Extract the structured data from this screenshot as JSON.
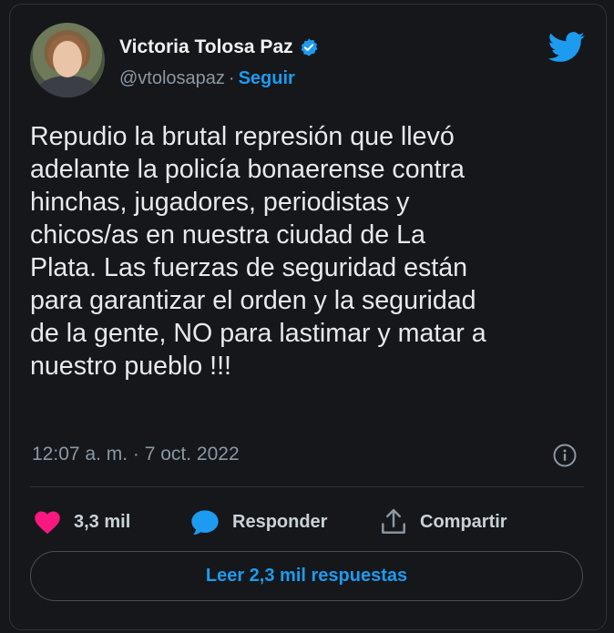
{
  "author": {
    "name": "Victoria Tolosa Paz",
    "handle": "@vtolosapaz",
    "separator": "·",
    "follow_label": "Seguir",
    "verified": true
  },
  "tweet": {
    "text": "Repudio la brutal represión que llevó\nadelante la policía bonaerense contra\nhinchas, jugadores, periodistas y\nchicos/as en nuestra ciudad de La\nPlata. Las fuerzas de seguridad están\npara garantizar el orden y la seguridad\nde la gente, NO para lastimar y matar a\nnuestro pueblo !!!",
    "timestamp": "12:07 a. m. · 7 oct. 2022"
  },
  "actions": {
    "likes_count": "3,3 mil",
    "reply_label": "Responder",
    "share_label": "Compartir"
  },
  "read_replies_label": "Leer 2,3 mil respuestas",
  "icons": {
    "brand": "twitter-bird-icon",
    "verified": "verified-badge-icon",
    "like": "heart-icon",
    "reply": "speech-bubble-icon",
    "share": "share-upload-icon",
    "info": "info-icon"
  },
  "colors": {
    "background": "#15171a",
    "accent": "#1d9bf0",
    "like": "#f91880",
    "secondary_text": "#8b98a5"
  }
}
